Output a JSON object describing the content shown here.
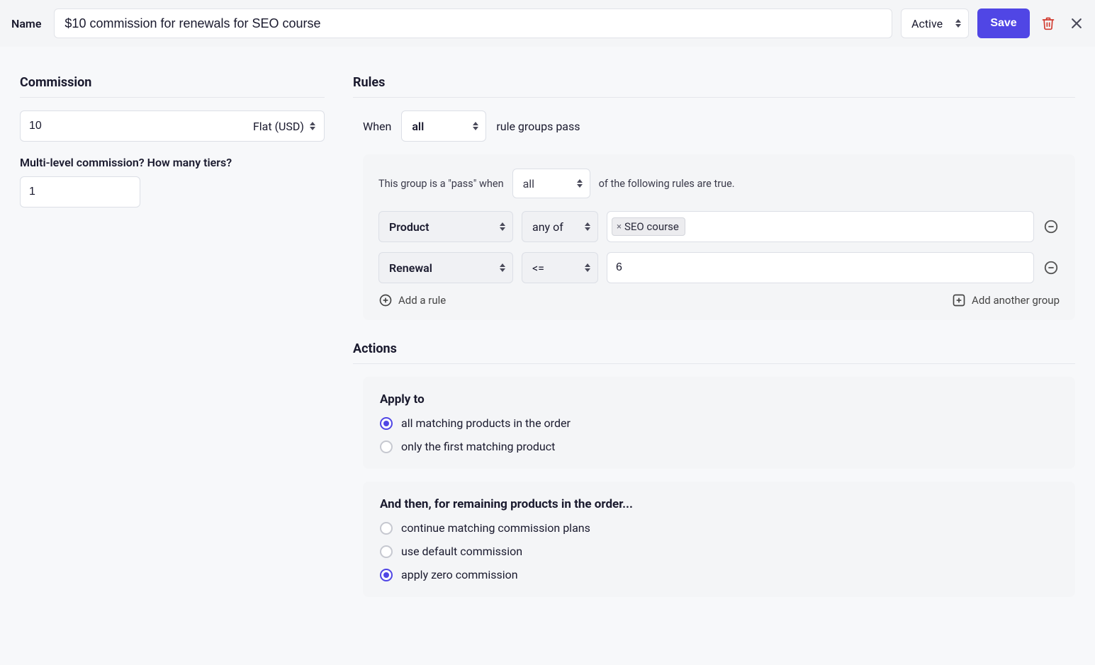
{
  "header": {
    "name_label": "Name",
    "name_value": "$10 commission for renewals for SEO course",
    "status": "Active",
    "save_label": "Save"
  },
  "commission": {
    "heading": "Commission",
    "value": "10",
    "type_label": "Flat (USD)",
    "multi_level_label": "Multi-level commission? How many tiers?",
    "tiers_value": "1"
  },
  "rules": {
    "heading": "Rules",
    "when_prefix": "When",
    "when_mode": "all",
    "when_suffix": "rule groups pass",
    "group": {
      "pass_prefix": "This group is a \"pass\" when",
      "pass_mode": "all",
      "pass_suffix": "of the following rules are true.",
      "rows": [
        {
          "field": "Product",
          "op": "any of",
          "tag": "SEO course"
        },
        {
          "field": "Renewal",
          "op": "<=",
          "value": "6"
        }
      ],
      "add_rule_label": "Add a rule",
      "add_group_label": "Add another group"
    }
  },
  "actions": {
    "heading": "Actions",
    "apply_to": {
      "title": "Apply to",
      "options": [
        "all matching products in the order",
        "only the first matching product"
      ],
      "selected": 0
    },
    "remaining": {
      "title": "And then, for remaining products in the order...",
      "options": [
        "continue matching commission plans",
        "use default commission",
        "apply zero commission"
      ],
      "selected": 2
    }
  }
}
